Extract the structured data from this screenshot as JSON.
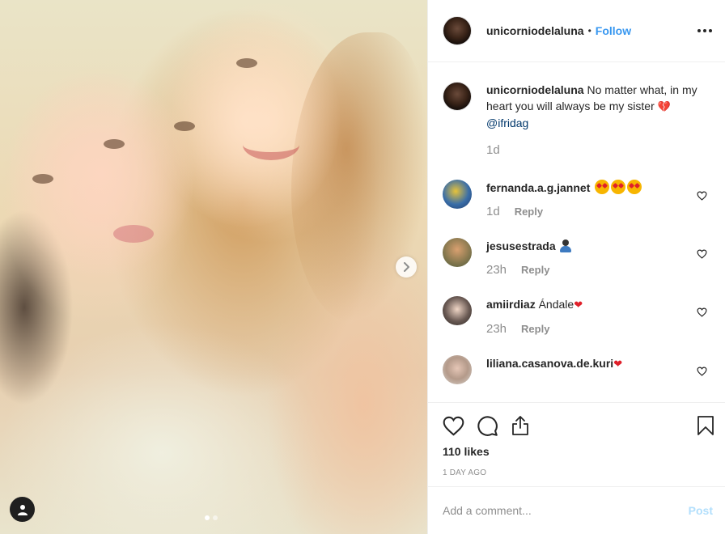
{
  "post": {
    "owner": "unicorniodelaluna",
    "follow_label": "Follow",
    "separator": "•"
  },
  "caption": {
    "username": "unicorniodelaluna",
    "text": "No matter what, in my heart you will always be my sister",
    "emoji": "💔",
    "mention": "@ifridag",
    "time": "1d"
  },
  "comments": [
    {
      "username": "fernanda.a.g.jannet",
      "text": "",
      "emoji": "😍😍😍",
      "time": "1d",
      "reply_label": "Reply"
    },
    {
      "username": "jesusestrada",
      "text": "",
      "emoji": "👤",
      "time": "23h",
      "reply_label": "Reply"
    },
    {
      "username": "amiirdiaz",
      "text": "Ándale",
      "emoji": "❤",
      "time": "23h",
      "reply_label": "Reply"
    },
    {
      "username": "liliana.casanova.de.kuri",
      "text": "",
      "emoji": "❤",
      "time": "",
      "reply_label": ""
    }
  ],
  "actions": {
    "likes": "110 likes",
    "time_ago": "1 DAY AGO"
  },
  "add_comment": {
    "placeholder": "Add a comment...",
    "post_label": "Post"
  },
  "colors": {
    "link_blue": "#3897f0",
    "post_disabled": "#b2dffc",
    "heart_red": "#e0202a",
    "muted_gray": "#8e8e8e"
  },
  "icons": [
    "next-arrow-icon",
    "tag-person-icon",
    "more-options-icon",
    "heart-icon",
    "comment-icon",
    "share-icon",
    "bookmark-icon"
  ]
}
